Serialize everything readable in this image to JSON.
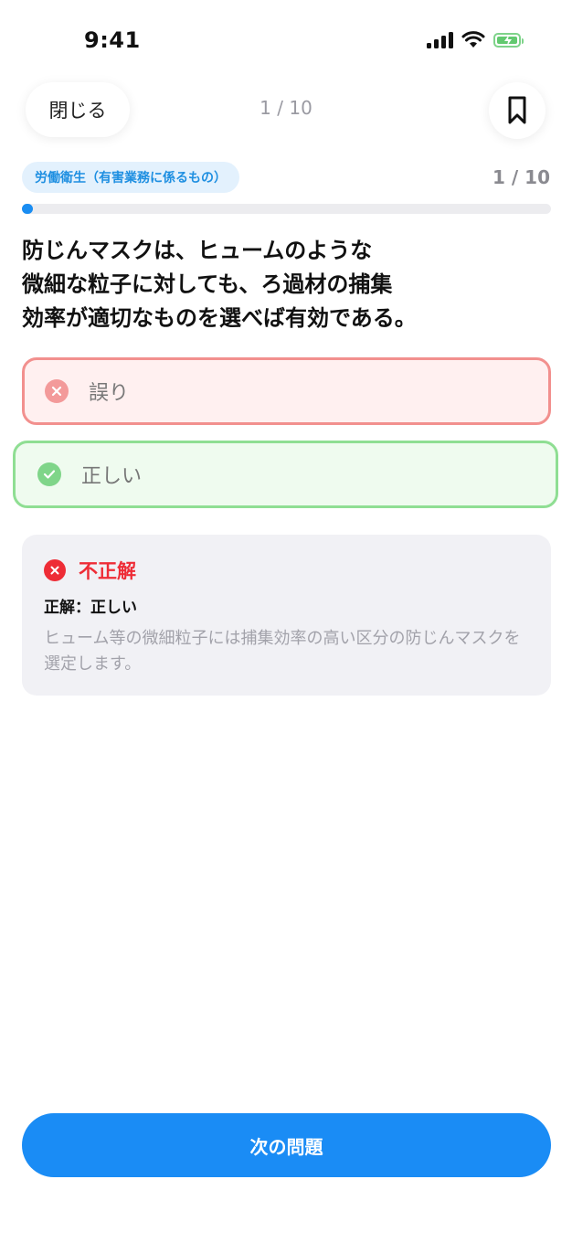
{
  "status_bar": {
    "time": "9:41"
  },
  "header": {
    "close_label": "閉じる",
    "progress_text": "1 / 10",
    "bookmark_icon": "bookmark-icon"
  },
  "quiz": {
    "category": "労働衛生（有害業務に係るもの）",
    "counter": "1 / 10",
    "progress_fraction": 0.02,
    "question": "防じんマスクは、ヒュームのような\n微細な粒子に対しても、ろ過材の捕集\n効率が適切なものを選べば有効である。",
    "options": [
      {
        "label": "誤り",
        "state": "selected-wrong",
        "icon": "x-circle-icon"
      },
      {
        "label": "正しい",
        "state": "correct",
        "icon": "check-circle-icon"
      }
    ]
  },
  "feedback": {
    "title": "不正解",
    "answer": "正解：正しい",
    "explanation": "ヒューム等の微細粒子には捕集効率の高い区分の防じんマスクを選定します。"
  },
  "footer": {
    "next_label": "次の問題"
  },
  "colors": {
    "accent": "#1a8cf5",
    "wrong": "#ee2c36",
    "correct": "#7fd589"
  }
}
